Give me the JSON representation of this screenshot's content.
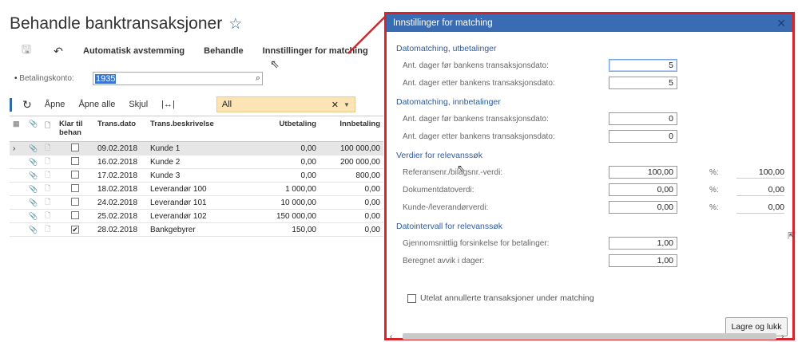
{
  "page": {
    "title": "Behandle banktransaksjoner"
  },
  "toolbar": {
    "auto_label": "Automatisk avstemming",
    "process_label": "Behandle",
    "settings_label": "Innstillinger for matching"
  },
  "account": {
    "label": "Betalingskonto:",
    "value": "1935"
  },
  "grid_toolbar": {
    "open": "Åpne",
    "open_all": "Åpne alle",
    "hide": "Skjul",
    "filter_value": "All"
  },
  "grid": {
    "headers": {
      "ready": "Klar til behan",
      "date": "Trans.dato",
      "desc": "Trans.beskrivelse",
      "out": "Utbetaling",
      "in": "Innbetaling"
    },
    "rows": [
      {
        "date": "09.02.2018",
        "desc": "Kunde 1",
        "out": "0,00",
        "in": "100 000,00",
        "checked": false
      },
      {
        "date": "16.02.2018",
        "desc": "Kunde 2",
        "out": "0,00",
        "in": "200 000,00",
        "checked": false
      },
      {
        "date": "17.02.2018",
        "desc": "Kunde 3",
        "out": "0,00",
        "in": "800,00",
        "checked": false
      },
      {
        "date": "18.02.2018",
        "desc": "Leverandør 100",
        "out": "1 000,00",
        "in": "0,00",
        "checked": false
      },
      {
        "date": "24.02.2018",
        "desc": "Leverandør 101",
        "out": "10 000,00",
        "in": "0,00",
        "checked": false
      },
      {
        "date": "25.02.2018",
        "desc": "Leverandør 102",
        "out": "150 000,00",
        "in": "0,00",
        "checked": false
      },
      {
        "date": "28.02.2018",
        "desc": "Bankgebyrer",
        "out": "150,00",
        "in": "0,00",
        "checked": true
      }
    ]
  },
  "dialog": {
    "title": "Innstillinger for matching",
    "sec1": "Datomatching, utbetalinger",
    "sec1_before_label": "Ant. dager før bankens transaksjonsdato:",
    "sec1_before_value": "5",
    "sec1_after_label": "Ant. dager etter bankens transaksjonsdato:",
    "sec1_after_value": "5",
    "sec2": "Datomatching, innbetalinger",
    "sec2_before_label": "Ant. dager før bankens transaksjonsdato:",
    "sec2_before_value": "0",
    "sec2_after_label": "Ant. dager etter bankens transaksjonsdato:",
    "sec2_after_value": "0",
    "sec3": "Verdier for relevanssøk",
    "ref_label": "Referansenr./bilagsnr.-verdi:",
    "ref_value": "100,00",
    "ref_pct": "100,00",
    "doc_label": "Dokumentdatoverdi:",
    "doc_value": "0,00",
    "doc_pct": "0,00",
    "cust_label": "Kunde-/leverandørverdi:",
    "cust_value": "0,00",
    "cust_pct": "0,00",
    "pct_sign": "%:",
    "sec4": "Datointervall for relevanssøk",
    "delay_label": "Gjennomsnittlig forsinkelse for betalinger:",
    "delay_value": "1,00",
    "dev_label": "Beregnet avvik i dager:",
    "dev_value": "1,00",
    "exclude_label": "Utelat annullerte transaksjoner under matching",
    "save_label": "Lagre og lukk"
  },
  "colors": {
    "accent": "#3a6cb3",
    "callout": "#d8232a",
    "filter_bg": "#fde4b4"
  }
}
